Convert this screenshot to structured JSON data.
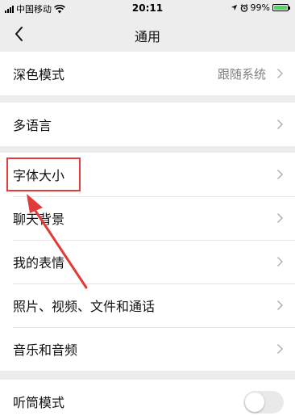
{
  "status_bar": {
    "carrier": "中国移动",
    "time": "20:11",
    "battery": "99%",
    "battery_level": 0.99
  },
  "nav": {
    "title": "通用",
    "back_icon": "chevron-left-icon"
  },
  "groups": [
    {
      "items": [
        {
          "label": "深色模式",
          "value": "跟随系统",
          "accessory": "chevron-right-icon"
        }
      ]
    },
    {
      "items": [
        {
          "label": "多语言",
          "accessory": "chevron-right-icon"
        }
      ]
    },
    {
      "items": [
        {
          "label": "字体大小",
          "accessory": "chevron-right-icon",
          "highlighted": true
        },
        {
          "label": "聊天背景",
          "accessory": "chevron-right-icon"
        },
        {
          "label": "我的表情",
          "accessory": "chevron-right-icon"
        },
        {
          "label": "照片、视频、文件和通话",
          "accessory": "chevron-right-icon"
        },
        {
          "label": "音乐和音频",
          "accessory": "chevron-right-icon"
        }
      ]
    },
    {
      "items": [
        {
          "label": "听筒模式",
          "accessory": "toggle",
          "toggle_on": false
        }
      ]
    }
  ],
  "colors": {
    "background": "#ededed",
    "annotation": "#e23a3a",
    "chevron": "#b2b2b2",
    "value_text": "#808080"
  }
}
